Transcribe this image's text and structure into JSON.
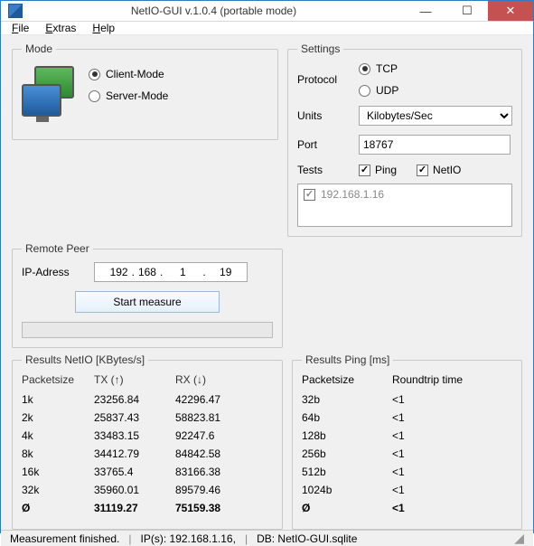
{
  "window": {
    "title": "NetIO-GUI v.1.0.4 (portable mode)"
  },
  "menu": {
    "file": "File",
    "extras": "Extras",
    "help": "Help"
  },
  "mode": {
    "legend": "Mode",
    "client": "Client-Mode",
    "server": "Server-Mode"
  },
  "settings": {
    "legend": "Settings",
    "protocol_label": "Protocol",
    "tcp": "TCP",
    "udp": "UDP",
    "units_label": "Units",
    "units_value": "Kilobytes/Sec",
    "port_label": "Port",
    "port_value": "18767",
    "tests_label": "Tests",
    "ping_label": "Ping",
    "netio_label": "NetIO",
    "ip_list_item": "192.168.1.16"
  },
  "remote": {
    "legend": "Remote Peer",
    "ip_label": "IP-Adress",
    "ip_oct1": "192",
    "ip_oct2": "168",
    "ip_oct3": "1",
    "ip_oct4": "19",
    "start_btn": "Start measure"
  },
  "results_netio": {
    "legend": "Results NetIO [KBytes/s]",
    "col_packet": "Packetsize",
    "col_tx": "TX (↑)",
    "col_rx": "RX (↓)",
    "rows": [
      {
        "ps": "1k",
        "tx": "23256.84",
        "rx": "42296.47"
      },
      {
        "ps": "2k",
        "tx": "25837.43",
        "rx": "58823.81"
      },
      {
        "ps": "4k",
        "tx": "33483.15",
        "rx": "92247.6"
      },
      {
        "ps": "8k",
        "tx": "34412.79",
        "rx": "84842.58"
      },
      {
        "ps": "16k",
        "tx": "33765.4",
        "rx": "83166.38"
      },
      {
        "ps": "32k",
        "tx": "35960.01",
        "rx": "89579.46"
      }
    ],
    "avg": {
      "ps": "Ø",
      "tx": "31119.27",
      "rx": "75159.38"
    }
  },
  "results_ping": {
    "legend": "Results Ping [ms]",
    "col_packet": "Packetsize",
    "col_rtt": "Roundtrip time",
    "rows": [
      {
        "ps": "32b",
        "rtt": "<1"
      },
      {
        "ps": "64b",
        "rtt": "<1"
      },
      {
        "ps": "128b",
        "rtt": "<1"
      },
      {
        "ps": "256b",
        "rtt": "<1"
      },
      {
        "ps": "512b",
        "rtt": "<1"
      },
      {
        "ps": "1024b",
        "rtt": "<1"
      }
    ],
    "avg": {
      "ps": "Ø",
      "rtt": "<1"
    }
  },
  "status": {
    "msg": "Measurement finished.",
    "ips": "IP(s): 192.168.1.16,",
    "db": "DB: NetIO-GUI.sqlite"
  }
}
